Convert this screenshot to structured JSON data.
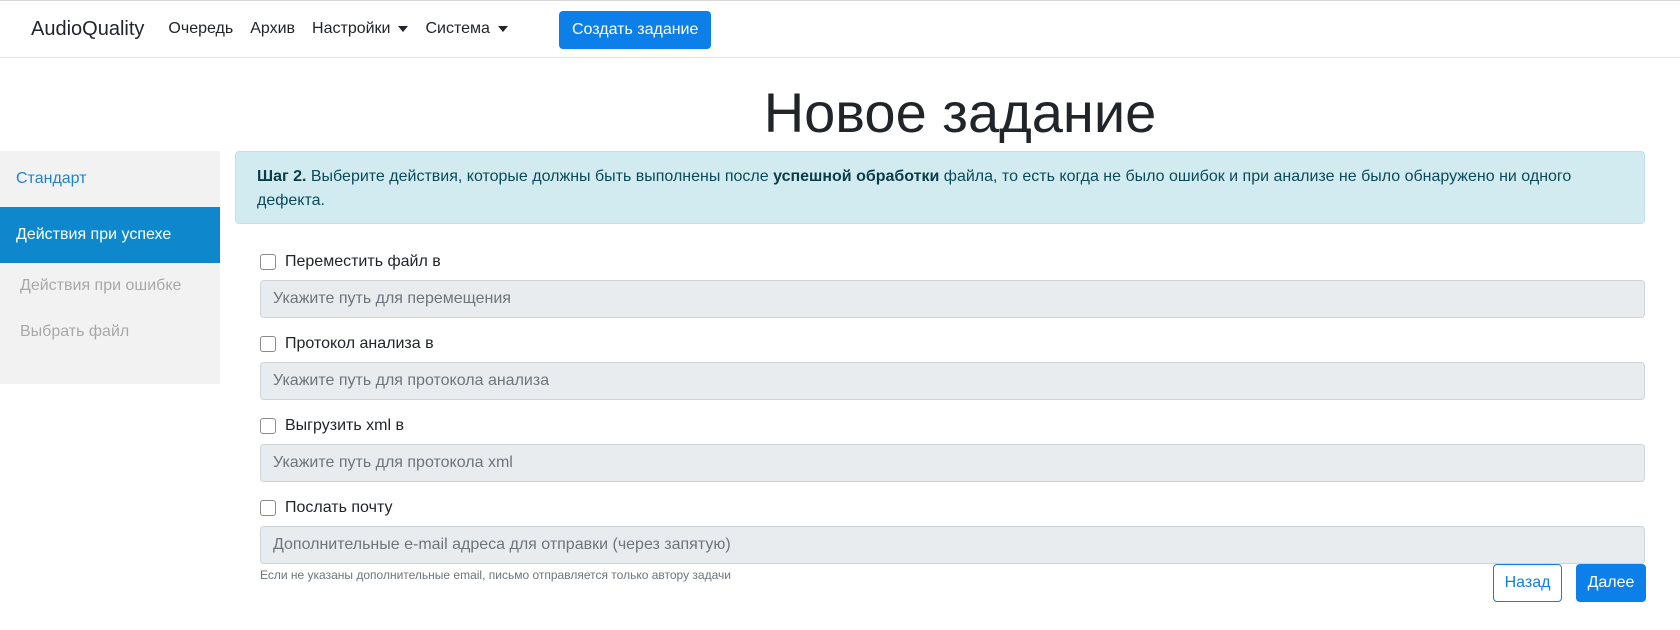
{
  "navbar": {
    "brand": "AudioQuality",
    "links": [
      "Очередь",
      "Архив",
      "Настройки",
      "Система"
    ],
    "create_button": "Создать задание"
  },
  "page": {
    "title": "Новое задание"
  },
  "sidebar": {
    "items": [
      {
        "label": "Стандарт",
        "state": "link"
      },
      {
        "label": "Действия при успехе",
        "state": "active"
      },
      {
        "label": "Действия при ошибке",
        "state": "disabled"
      },
      {
        "label": "Выбрать файл",
        "state": "disabled"
      }
    ]
  },
  "alert": {
    "step": "Шаг 2.",
    "text_before": " Выберите действия, которые должны быть выполнены после ",
    "emphasis": "успешной обработки",
    "text_after": " файла, то есть когда не было ошибок и при анализе не было обнаружено ни одного дефекта."
  },
  "form": {
    "move": {
      "label": "Переместить файл в",
      "placeholder": "Укажите путь для перемещения",
      "checked": false
    },
    "protocol": {
      "label": "Протокол анализа в",
      "placeholder": "Укажите путь для протокола анализа",
      "checked": false
    },
    "xml": {
      "label": "Выгрузить xml в",
      "placeholder": "Укажите путь для протокола xml",
      "checked": false
    },
    "mail": {
      "label": "Послать почту",
      "placeholder": "Дополнительные e-mail адреса для отправки (через запятую)",
      "checked": false,
      "help": "Если не указаны дополнительные email, письмо отправляется только автору задачи"
    }
  },
  "actions": {
    "back": "Назад",
    "next": "Далее"
  },
  "colors": {
    "primary": "#0d7fe8",
    "sidebar_active": "#0e87cd",
    "alert_bg": "#d1ebf1"
  }
}
